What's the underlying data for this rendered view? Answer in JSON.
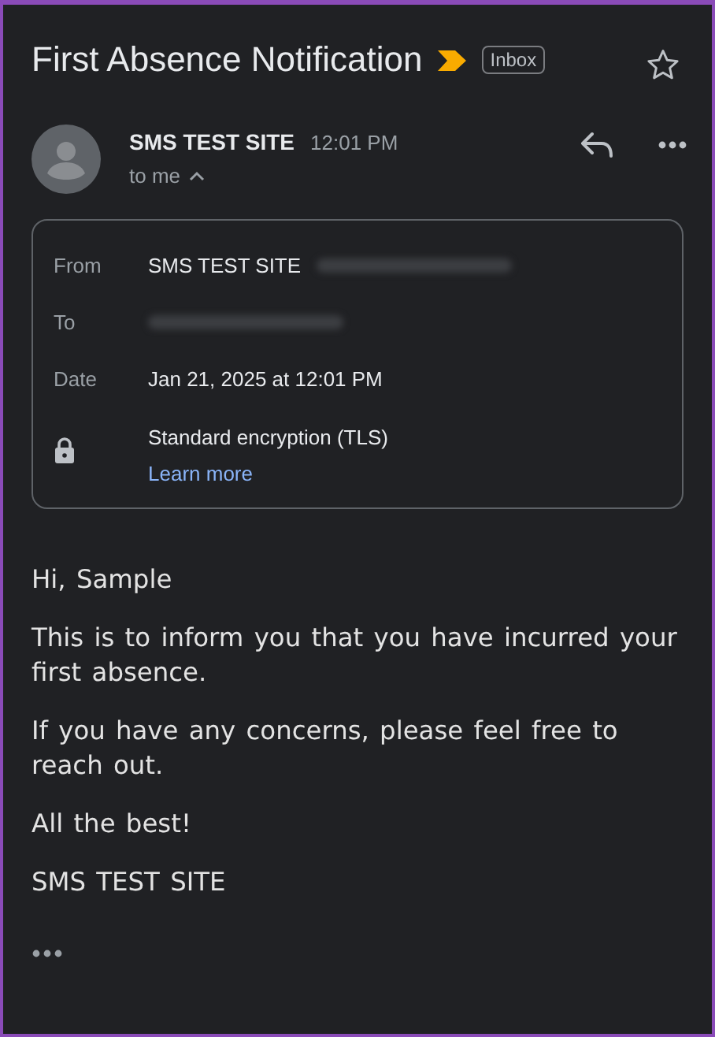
{
  "subject": "First Absence Notification",
  "important": true,
  "label": "Inbox",
  "starred": false,
  "sender": {
    "name": "SMS TEST SITE",
    "time": "12:01 PM",
    "recipient": "to me",
    "expanded": true
  },
  "details": [
    {
      "kind": "field",
      "label": "From",
      "value": "SMS TEST SITE",
      "redacted": true
    },
    {
      "kind": "field",
      "label": "To",
      "redacted": true
    },
    {
      "kind": "field",
      "label": "Date",
      "value": "Jan 21, 2025 at 12:01 PM"
    },
    {
      "kind": "security",
      "value": "Standard encryption (TLS)",
      "link": "Learn more"
    }
  ],
  "body": [
    "Hi, Sample",
    "This is to inform you that you have incurred your first absence.",
    "If you have any concerns, please feel free to reach out.",
    "All the best!",
    "SMS TEST SITE"
  ],
  "trimmed": true
}
